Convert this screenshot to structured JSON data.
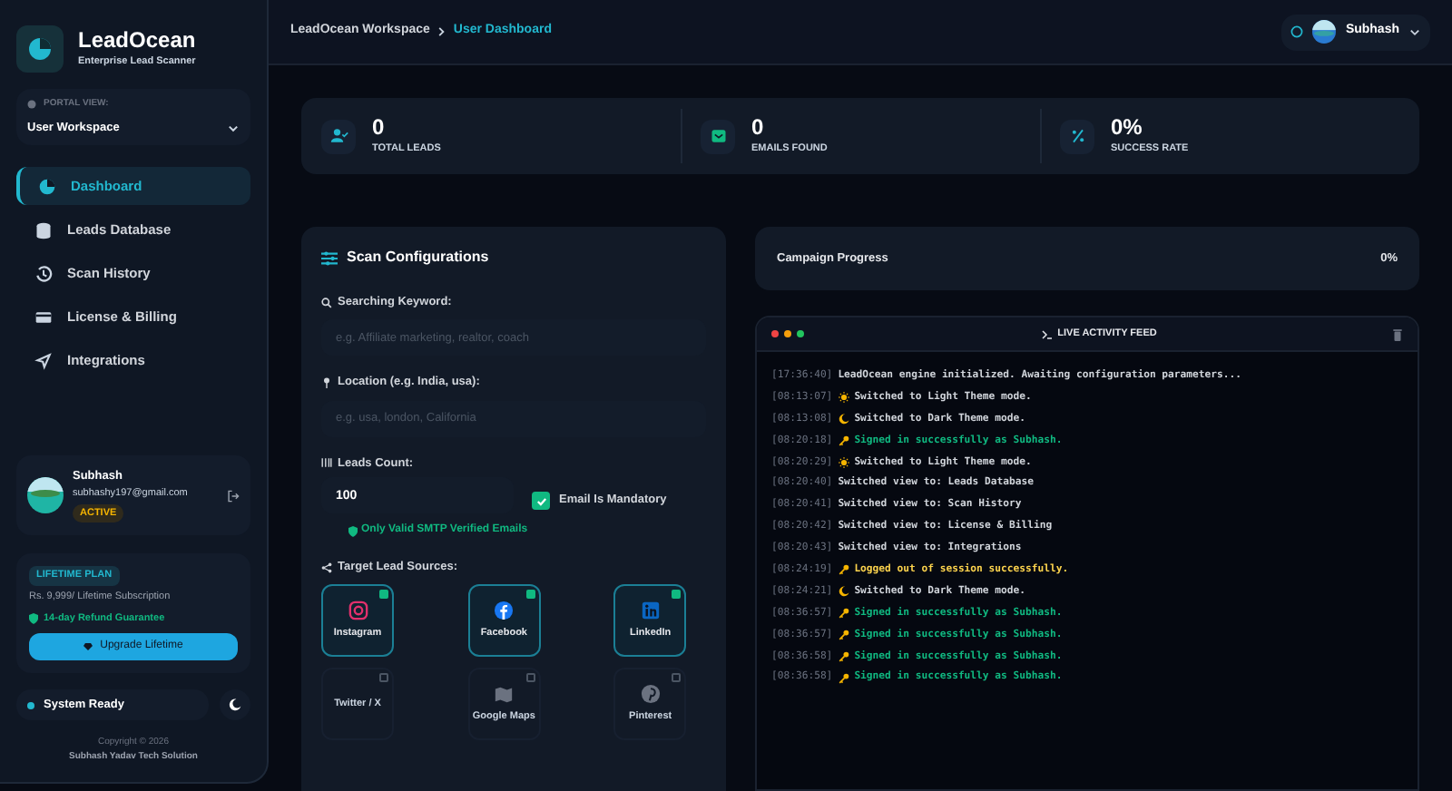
{
  "brand": {
    "name": "LeadOcean",
    "tagline": "Enterprise Lead Scanner"
  },
  "portal": {
    "label": "PORTAL VIEW:",
    "value": "User Workspace"
  },
  "nav": [
    {
      "label": "Dashboard",
      "selected": true
    },
    {
      "label": "Leads Database",
      "selected": false
    },
    {
      "label": "Scan History",
      "selected": false
    },
    {
      "label": "License & Billing",
      "selected": false
    },
    {
      "label": "Integrations",
      "selected": false
    }
  ],
  "user": {
    "name": "Subhash",
    "email": "subhashy197@gmail.com",
    "status": "ACTIVE"
  },
  "plan": {
    "badge": "LIFETIME PLAN",
    "price": "Rs. 9,999/ Lifetime Subscription",
    "guarantee": "14-day Refund Guarantee",
    "button": "Upgrade Lifetime"
  },
  "system": {
    "label": "System Ready"
  },
  "footer": {
    "copyright": "Copyright © 2026",
    "company": "Subhash Yadav Tech Solution"
  },
  "breadcrumb": [
    {
      "label": "LeadOcean Workspace",
      "selected": false
    },
    {
      "label": "User Dashboard",
      "selected": true
    }
  ],
  "header_user": {
    "name": "Subhash"
  },
  "stats": [
    {
      "value": "0",
      "label": "TOTAL LEADS",
      "kind": "leads"
    },
    {
      "value": "0",
      "label": "EMAILS FOUND",
      "kind": "emails"
    },
    {
      "value": "0%",
      "label": "SUCCESS RATE",
      "kind": "rate"
    }
  ],
  "scan": {
    "title": "Scan Configurations",
    "keyword": {
      "label": "Searching Keyword:",
      "placeholder": "e.g. Affiliate marketing, realtor, coach"
    },
    "location": {
      "label": "Location (e.g. India, usa):",
      "placeholder": "e.g. usa, london, California"
    },
    "count": {
      "label": "Leads Count:",
      "value": "100"
    },
    "email_mandatory": {
      "label": "Email Is Mandatory",
      "checked": true
    },
    "smtp_note": "Only Valid SMTP Verified Emails",
    "sources_label": "Target Lead Sources:",
    "sources": [
      {
        "label": "Instagram",
        "kind": "instagram",
        "selected": true
      },
      {
        "label": "Facebook",
        "kind": "facebook",
        "selected": true
      },
      {
        "label": "LinkedIn",
        "kind": "linkedin",
        "selected": true
      },
      {
        "label": "Twitter / X",
        "kind": "twitter",
        "selected": false
      },
      {
        "label": "Google Maps",
        "kind": "maps",
        "selected": false
      },
      {
        "label": "Pinterest",
        "kind": "pinterest",
        "selected": false
      }
    ]
  },
  "campaign": {
    "label": "Campaign Progress",
    "percent": "0%"
  },
  "feed": {
    "title": "LIVE ACTIVITY FEED",
    "entries": [
      {
        "time": "[17:36:40]",
        "text": "LeadOcean engine initialized. Awaiting configuration parameters...",
        "kind": "plain"
      },
      {
        "time": "[08:13:07]",
        "text": "Switched to Light Theme mode.",
        "kind": "light"
      },
      {
        "time": "[08:13:08]",
        "text": "Switched to Dark Theme mode.",
        "kind": "dark"
      },
      {
        "time": "[08:20:18]",
        "text": "Signed in successfully as Subhash.",
        "kind": "signin"
      },
      {
        "time": "[08:20:29]",
        "text": "Switched to Light Theme mode.",
        "kind": "light"
      },
      {
        "time": "[08:20:40]",
        "text": "Switched view to: Leads Database",
        "kind": "plain"
      },
      {
        "time": "[08:20:41]",
        "text": "Switched view to: Scan History",
        "kind": "plain"
      },
      {
        "time": "[08:20:42]",
        "text": "Switched view to: License & Billing",
        "kind": "plain"
      },
      {
        "time": "[08:20:43]",
        "text": "Switched view to: Integrations",
        "kind": "plain"
      },
      {
        "time": "[08:24:19]",
        "text": "Logged out of session successfully.",
        "kind": "logout"
      },
      {
        "time": "[08:24:21]",
        "text": "Switched to Dark Theme mode.",
        "kind": "dark"
      },
      {
        "time": "[08:36:57]",
        "text": "Signed in successfully as Subhash.",
        "kind": "signin"
      },
      {
        "time": "[08:36:57]",
        "text": "Signed in successfully as Subhash.",
        "kind": "signin"
      },
      {
        "time": "[08:36:58]",
        "text": "Signed in successfully as Subhash.",
        "kind": "signin"
      },
      {
        "time": "[08:36:58]",
        "text": "Signed in successfully as Subhash.",
        "kind": "signin"
      }
    ]
  }
}
